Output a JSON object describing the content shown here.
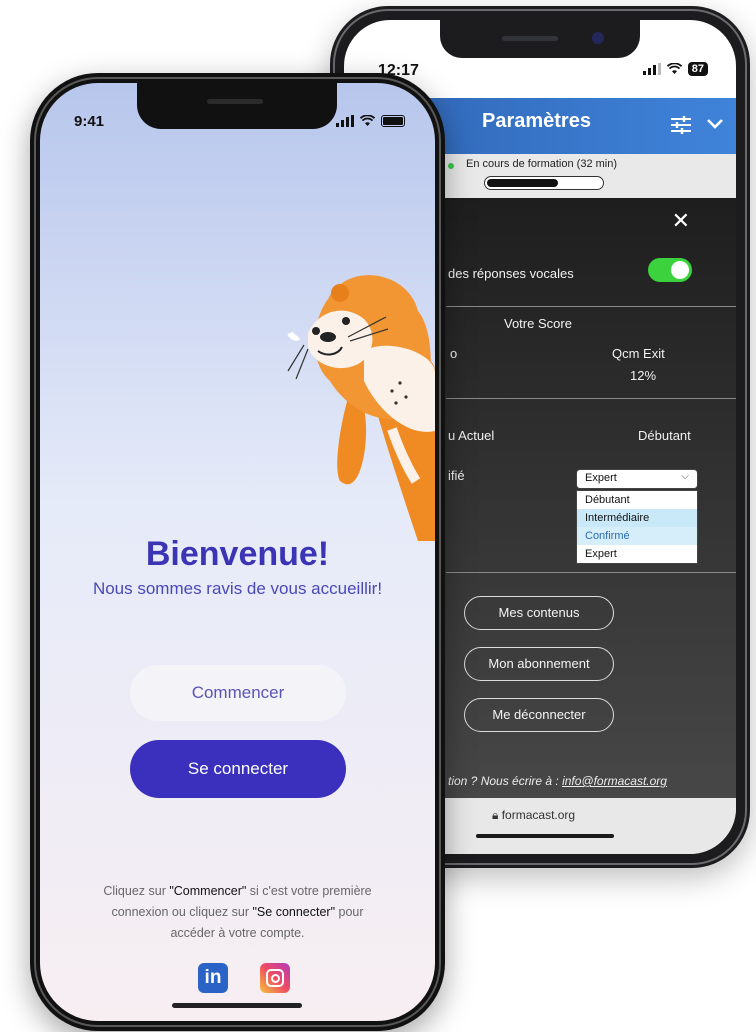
{
  "back_phone": {
    "status_time": "12:17",
    "battery": "87",
    "header": {
      "title": "Paramètres",
      "filter_icon": "sliders-icon",
      "chevron_icon": "chevron-down-icon"
    },
    "training": {
      "label": "En cours de formation (32 min)",
      "progress_fraction": 0.62
    },
    "settings": {
      "voice_label": "des réponses vocales",
      "voice_enabled": true,
      "score_heading": "Votre Score",
      "score_left_label": "o",
      "score_qcm_label": "Qcm Exit",
      "score_qcm_value": "12%",
      "level_label": "u Actuel",
      "level_value": "Débutant",
      "confirm_label": "ifié",
      "select_value": "Expert",
      "select_options": [
        "Débutant",
        "Intermédiaire",
        "Confirmé",
        "Expert"
      ],
      "highlighted_option": "Confirmé"
    },
    "buttons": {
      "contents": "Mes contenus",
      "subscription": "Mon abonnement",
      "logout": "Me déconnecter"
    },
    "contact_text": "tion ? Nous écrire à : ",
    "contact_email": "info@formacast.org",
    "url": "formacast.org"
  },
  "front_phone": {
    "status_time": "9:41",
    "welcome_title": "Bienvenue!",
    "welcome_subtitle": "Nous sommes ravis de vous accueillir!",
    "start_button": "Commencer",
    "login_button": "Se connecter",
    "help": {
      "p1": "Cliquez sur ",
      "start_ref": "\"Commencer\"",
      "p2": " si c'est votre première connexion ou cliquez sur ",
      "login_ref": "\"Se connecter\"",
      "p3": " pour accéder à votre compte."
    },
    "social": {
      "linkedin": "in",
      "linkedin_icon": "linkedin-icon",
      "instagram_icon": "instagram-icon"
    },
    "mascot": "otter-mascot"
  }
}
